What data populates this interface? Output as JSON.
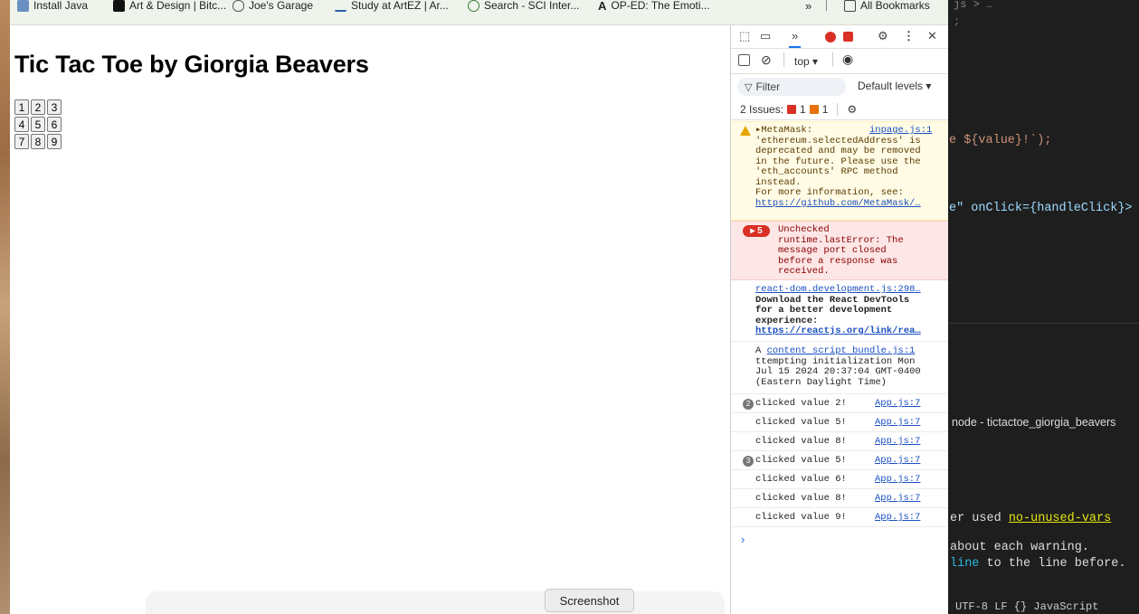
{
  "bookmarks": [
    {
      "label": "Install Java",
      "color": "#6a8fc0"
    },
    {
      "label": "Art & Design | Bitc...",
      "color": "#111111"
    },
    {
      "label": "Joe's Garage",
      "color": "#555555"
    },
    {
      "label": "Study at ArtEZ | Ar...",
      "color": "#2a5fb0"
    },
    {
      "label": "Search - SCI Inter...",
      "color": "#3b7a3b"
    },
    {
      "label": "OP-ED: The Emoti...",
      "color": "#111111"
    }
  ],
  "bookmarks_more": "»",
  "all_bookmarks": "All Bookmarks",
  "page": {
    "title": "Tic Tac Toe by Giorgia Beavers",
    "board": [
      [
        "1",
        "2",
        "3"
      ],
      [
        "4",
        "5",
        "6"
      ],
      [
        "7",
        "8",
        "9"
      ]
    ],
    "screenshot_label": "Screenshot"
  },
  "devtools": {
    "more_tabs": "»",
    "close": "✕",
    "context": "top ▾",
    "filter": "Filter",
    "levels": "Default levels ▾",
    "issues_label": "2 Issues:",
    "issues_error_count": "1",
    "issues_warn_count": "1",
    "warning": {
      "head": "▸MetaMask:",
      "source": "inpage.js:1",
      "lines": [
        "'ethereum.selectedAddress' is",
        "deprecated and may be removed",
        "in the future. Please use the",
        "'eth_accounts' RPC method",
        "instead.",
        "For more information, see:"
      ],
      "link": "https://github.com/MetaMask/…"
    },
    "error": {
      "count": "▸ 5",
      "lines": [
        "Unchecked",
        "runtime.lastError: The",
        "message port closed",
        "before a response was",
        "received."
      ]
    },
    "react": {
      "source": "react-dom.development.js:298…",
      "lines": [
        "Download the React DevTools",
        "for a better development",
        "experience:"
      ],
      "link": "https://reactjs.org/link/rea…"
    },
    "content": {
      "prefix": "A ",
      "source": "content script bundle.js:1",
      "lines": [
        "ttempting initialization Mon",
        "Jul 15 2024 20:37:04 GMT-0400",
        "(Eastern Daylight Time)"
      ]
    },
    "logs": [
      {
        "count": "2",
        "text": "clicked value 2!",
        "src": "App.js:7"
      },
      {
        "count": "",
        "text": "clicked value 5!",
        "src": "App.js:7"
      },
      {
        "count": "",
        "text": "clicked value 8!",
        "src": "App.js:7"
      },
      {
        "count": "3",
        "text": "clicked value 5!",
        "src": "App.js:7"
      },
      {
        "count": "",
        "text": "clicked value 6!",
        "src": "App.js:7"
      },
      {
        "count": "",
        "text": "clicked value 8!",
        "src": "App.js:7"
      },
      {
        "count": "",
        "text": "clicked value 9!",
        "src": "App.js:7"
      }
    ],
    "prompt": "›"
  },
  "editor": {
    "top_line": "js > …",
    "semicolon": ";",
    "template_line": "e ${value}!`);",
    "onclick_line": "e\" onClick={handleClick}>",
    "terminal_title": "node - tictactoe_giorgia_beavers",
    "lint_line_prefix": "er used  ",
    "lint_rule": "no-unused-vars",
    "hint1": "about each warning.",
    "hint2_keyword": "line",
    "hint2_rest": " to the line before.",
    "status": "UTF-8   LF   {} JavaScript",
    "colors": {
      "string": "#ce9178",
      "brace": "#569cd6",
      "var": "#9cdcfe",
      "func": "#dcdcaa",
      "link": "#e5e510"
    }
  }
}
